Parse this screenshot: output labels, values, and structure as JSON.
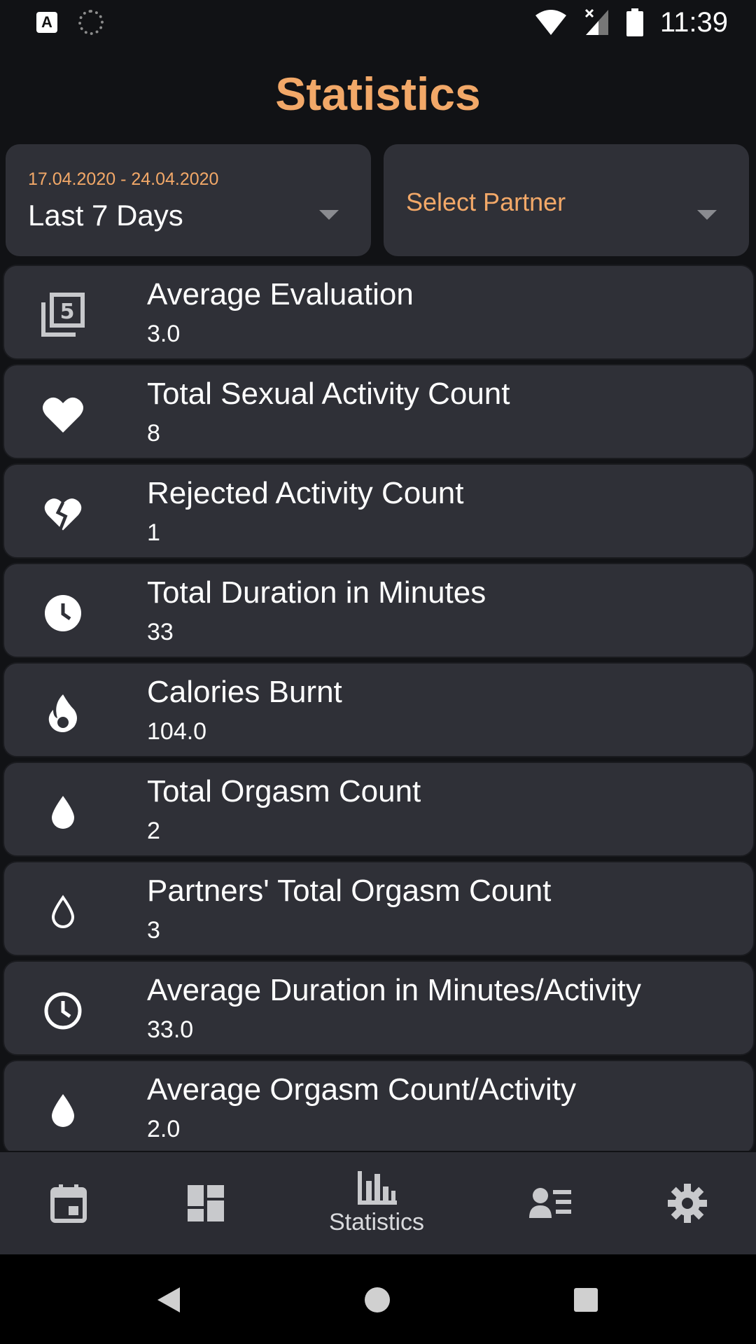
{
  "status_bar": {
    "time": "11:39",
    "left_icons": [
      "a-notification-icon",
      "sync-spinner-icon"
    ],
    "right_icons": [
      "wifi-icon",
      "cell-signal-icon",
      "battery-icon"
    ],
    "badge_letter": "A"
  },
  "page": {
    "title": "Statistics"
  },
  "filters": {
    "date_range": {
      "range_text": "17.04.2020 - 24.04.2020",
      "selected": "Last 7 Days"
    },
    "partner": {
      "placeholder": "Select Partner"
    }
  },
  "stats": [
    {
      "icon": "filter-5-icon",
      "title": "Average Evaluation",
      "value": "3.0"
    },
    {
      "icon": "heart-icon",
      "title": "Total Sexual Activity Count",
      "value": "8"
    },
    {
      "icon": "broken-heart-icon",
      "title": "Rejected Activity Count",
      "value": "1"
    },
    {
      "icon": "clock-filled-icon",
      "title": "Total Duration in Minutes",
      "value": "33"
    },
    {
      "icon": "flame-icon",
      "title": "Calories Burnt",
      "value": "104.0"
    },
    {
      "icon": "drop-filled-icon",
      "title": "Total Orgasm Count",
      "value": "2"
    },
    {
      "icon": "drop-outline-icon",
      "title": "Partners' Total Orgasm Count",
      "value": "3"
    },
    {
      "icon": "clock-outline-icon",
      "title": "Average Duration in Minutes/Activity",
      "value": "33.0"
    },
    {
      "icon": "drop-filled-icon",
      "title": "Average Orgasm Count/Activity",
      "value": "2.0"
    }
  ],
  "bottom_nav": {
    "items": [
      {
        "icon": "calendar-icon",
        "label": ""
      },
      {
        "icon": "dashboard-icon",
        "label": ""
      },
      {
        "icon": "bar-chart-icon",
        "label": "Statistics",
        "active": true
      },
      {
        "icon": "contacts-list-icon",
        "label": ""
      },
      {
        "icon": "gear-icon",
        "label": ""
      }
    ]
  },
  "colors": {
    "accent": "#f2a868",
    "background": "#111215",
    "card": "#2f3037",
    "nav": "#2b2c33"
  }
}
